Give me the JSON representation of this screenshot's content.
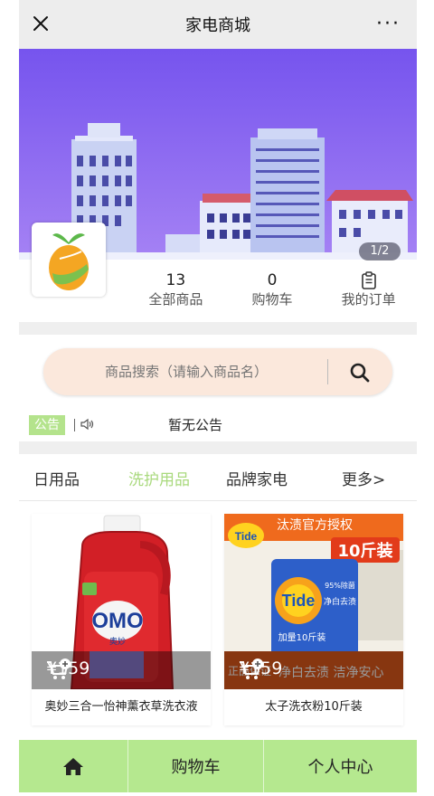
{
  "header": {
    "title": "家电商城",
    "more_glyph": "···",
    "close_icon": "close-icon"
  },
  "banner": {
    "pager": "1/2",
    "colors": {
      "sky_top": "#7d5cf0",
      "sky_bottom": "#a07cf5"
    }
  },
  "shop_stats": [
    {
      "value": "13",
      "label": "全部商品"
    },
    {
      "value": "0",
      "label": "购物车"
    },
    {
      "icon": "order-list-icon",
      "label": "我的订单"
    }
  ],
  "search": {
    "placeholder": "商品搜索（请输入商品名）",
    "button_icon": "search-icon"
  },
  "notice": {
    "tag": "公告",
    "text": "暂无公告"
  },
  "tabs": [
    {
      "label": "日用品",
      "active": false
    },
    {
      "label": "洗护用品",
      "active": true
    },
    {
      "label": "品牌家电",
      "active": false
    },
    {
      "label": "更多>",
      "active": false
    }
  ],
  "products": [
    {
      "price": "¥159",
      "name": "奥妙三合一怡神薰衣草洗衣液",
      "image_labels": {
        "brand": "OMO",
        "sub": "奥妙"
      }
    },
    {
      "price": "¥159",
      "name": "太子洗衣粉10斤装",
      "image_labels": {
        "top": "汰渍官方授权",
        "big": "10斤装",
        "brand": "Tide",
        "promo": "95%除菌",
        "white": "净白去渍",
        "weight": "加量10斤装",
        "ribbon1": "正品保证",
        "ribbon2": "净白去渍 洁净安心"
      }
    }
  ],
  "bottom_nav": [
    {
      "icon": "home-icon",
      "label": ""
    },
    {
      "label": "购物车"
    },
    {
      "label": "个人中心"
    }
  ],
  "colors": {
    "accent": "#a9d97d",
    "nav_bg": "#b5e88f",
    "search_bg": "#fbe8dc"
  }
}
